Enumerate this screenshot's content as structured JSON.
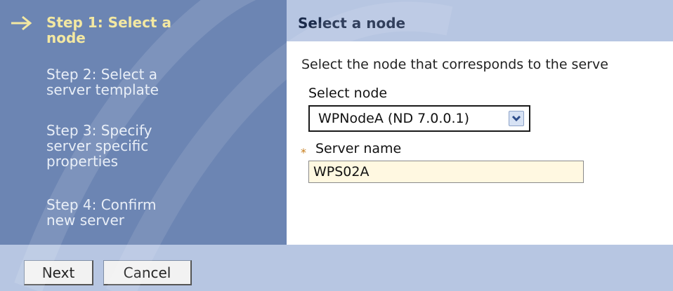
{
  "wizard": {
    "steps": [
      {
        "line1": "Step 1: Select a",
        "line2": "node",
        "current": true
      },
      {
        "line1": "Step 2: Select a",
        "line2": "server template",
        "current": false
      },
      {
        "line1": "Step 3: Specify",
        "line2": "server specific",
        "line3": "properties",
        "current": false
      },
      {
        "line1": "Step 4: Confirm",
        "line2": "new server",
        "current": false
      }
    ],
    "current_step_icon": "right-arrow-icon"
  },
  "content": {
    "title": "Select a node",
    "description": "Select the node that corresponds to the serve",
    "select_node_label": "Select node",
    "select_node_value": "WPNodeA (ND 7.0.0.1)",
    "required_marker": "*",
    "server_name_label": "Server name",
    "server_name_value": "WPS02A"
  },
  "footer": {
    "next_label": "Next",
    "cancel_label": "Cancel"
  },
  "colors": {
    "steps_panel": "#6c85b3",
    "header_bar": "#b7c6e2",
    "current_step_text": "#f3e8a2",
    "input_background": "#fff8e1"
  }
}
